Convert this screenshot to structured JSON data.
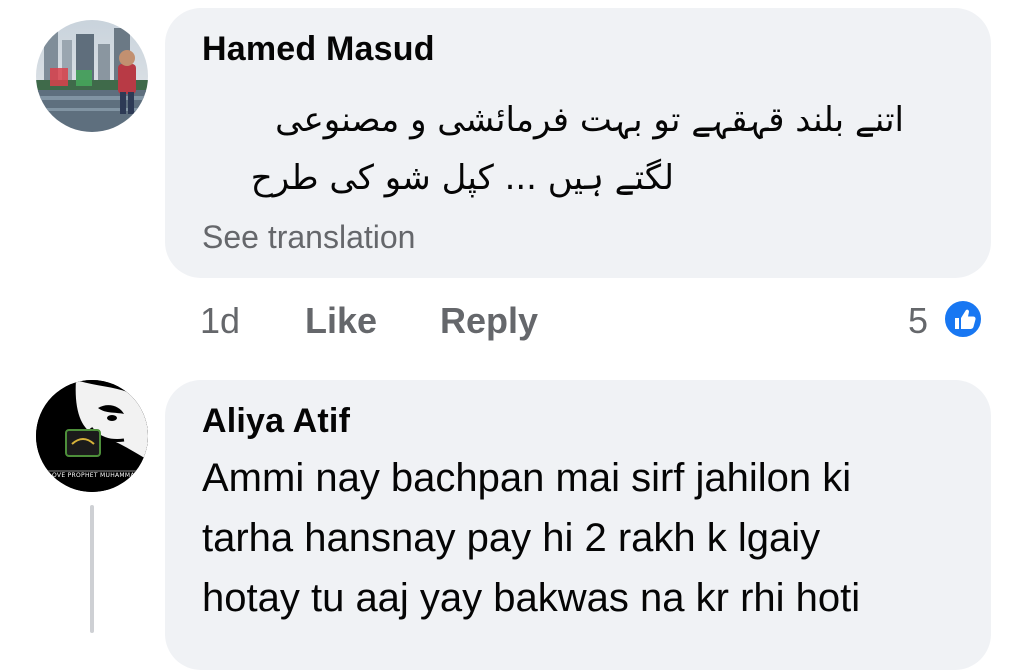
{
  "comments": [
    {
      "author": "Hamed Masud",
      "text_lines": [
        "اتنے بلند قہقہے تو بہت فرمائشی و مصنوعی",
        "لگتے ہیں ... کپل شو کی طرح"
      ],
      "see_translation": "See translation",
      "time": "1d",
      "like_label": "Like",
      "reply_label": "Reply",
      "reaction_count": "5",
      "reaction_icon": "thumbs-up-icon"
    },
    {
      "author": "Aliya Atif",
      "text_lines": [
        "Ammi nay bachpan mai sirf jahilon ki",
        "tarha hansnay pay hi 2 rakh k lgaiy",
        "hotay tu aaj yay bakwas na kr rhi hoti"
      ],
      "avatar_caption": "I LOVE PROPHET MUHAMMAD"
    }
  ],
  "colors": {
    "bubble": "#f0f2f5",
    "meta_text": "#65676b",
    "like_blue": "#1877f2",
    "text": "#050505"
  }
}
